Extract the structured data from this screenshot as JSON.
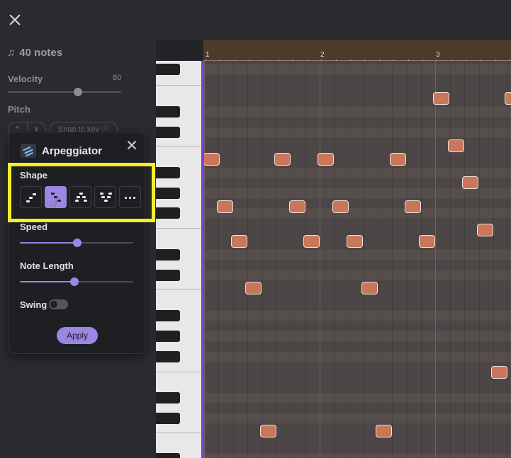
{
  "sidebar": {
    "notes_count": "40 notes",
    "velocity_label": "Velocity",
    "velocity_value": "80",
    "velocity_level": 0.8,
    "pitch_label": "Pitch",
    "pitch_up": "^",
    "pitch_down": "v",
    "snap_label": "Snap to key ⓘ"
  },
  "popup": {
    "title": "Arpeggiator",
    "shape_label": "Shape",
    "shapes": [
      "up",
      "down",
      "up-down",
      "down-up",
      "more"
    ],
    "selected_shape": "down",
    "speed_label": "Speed",
    "speed_level": 0.5,
    "note_length_label": "Note Length",
    "note_length_level": 0.48,
    "swing_label": "Swing",
    "swing_on": false,
    "apply_label": "Apply",
    "accent_color": "#9b86e6"
  },
  "ruler": {
    "bars": [
      "1",
      "2",
      "3"
    ],
    "color": "#4c3a2b"
  },
  "notes": {
    "count": 40,
    "color": "#c8775a",
    "highlight_color": "#f4ee2a"
  }
}
